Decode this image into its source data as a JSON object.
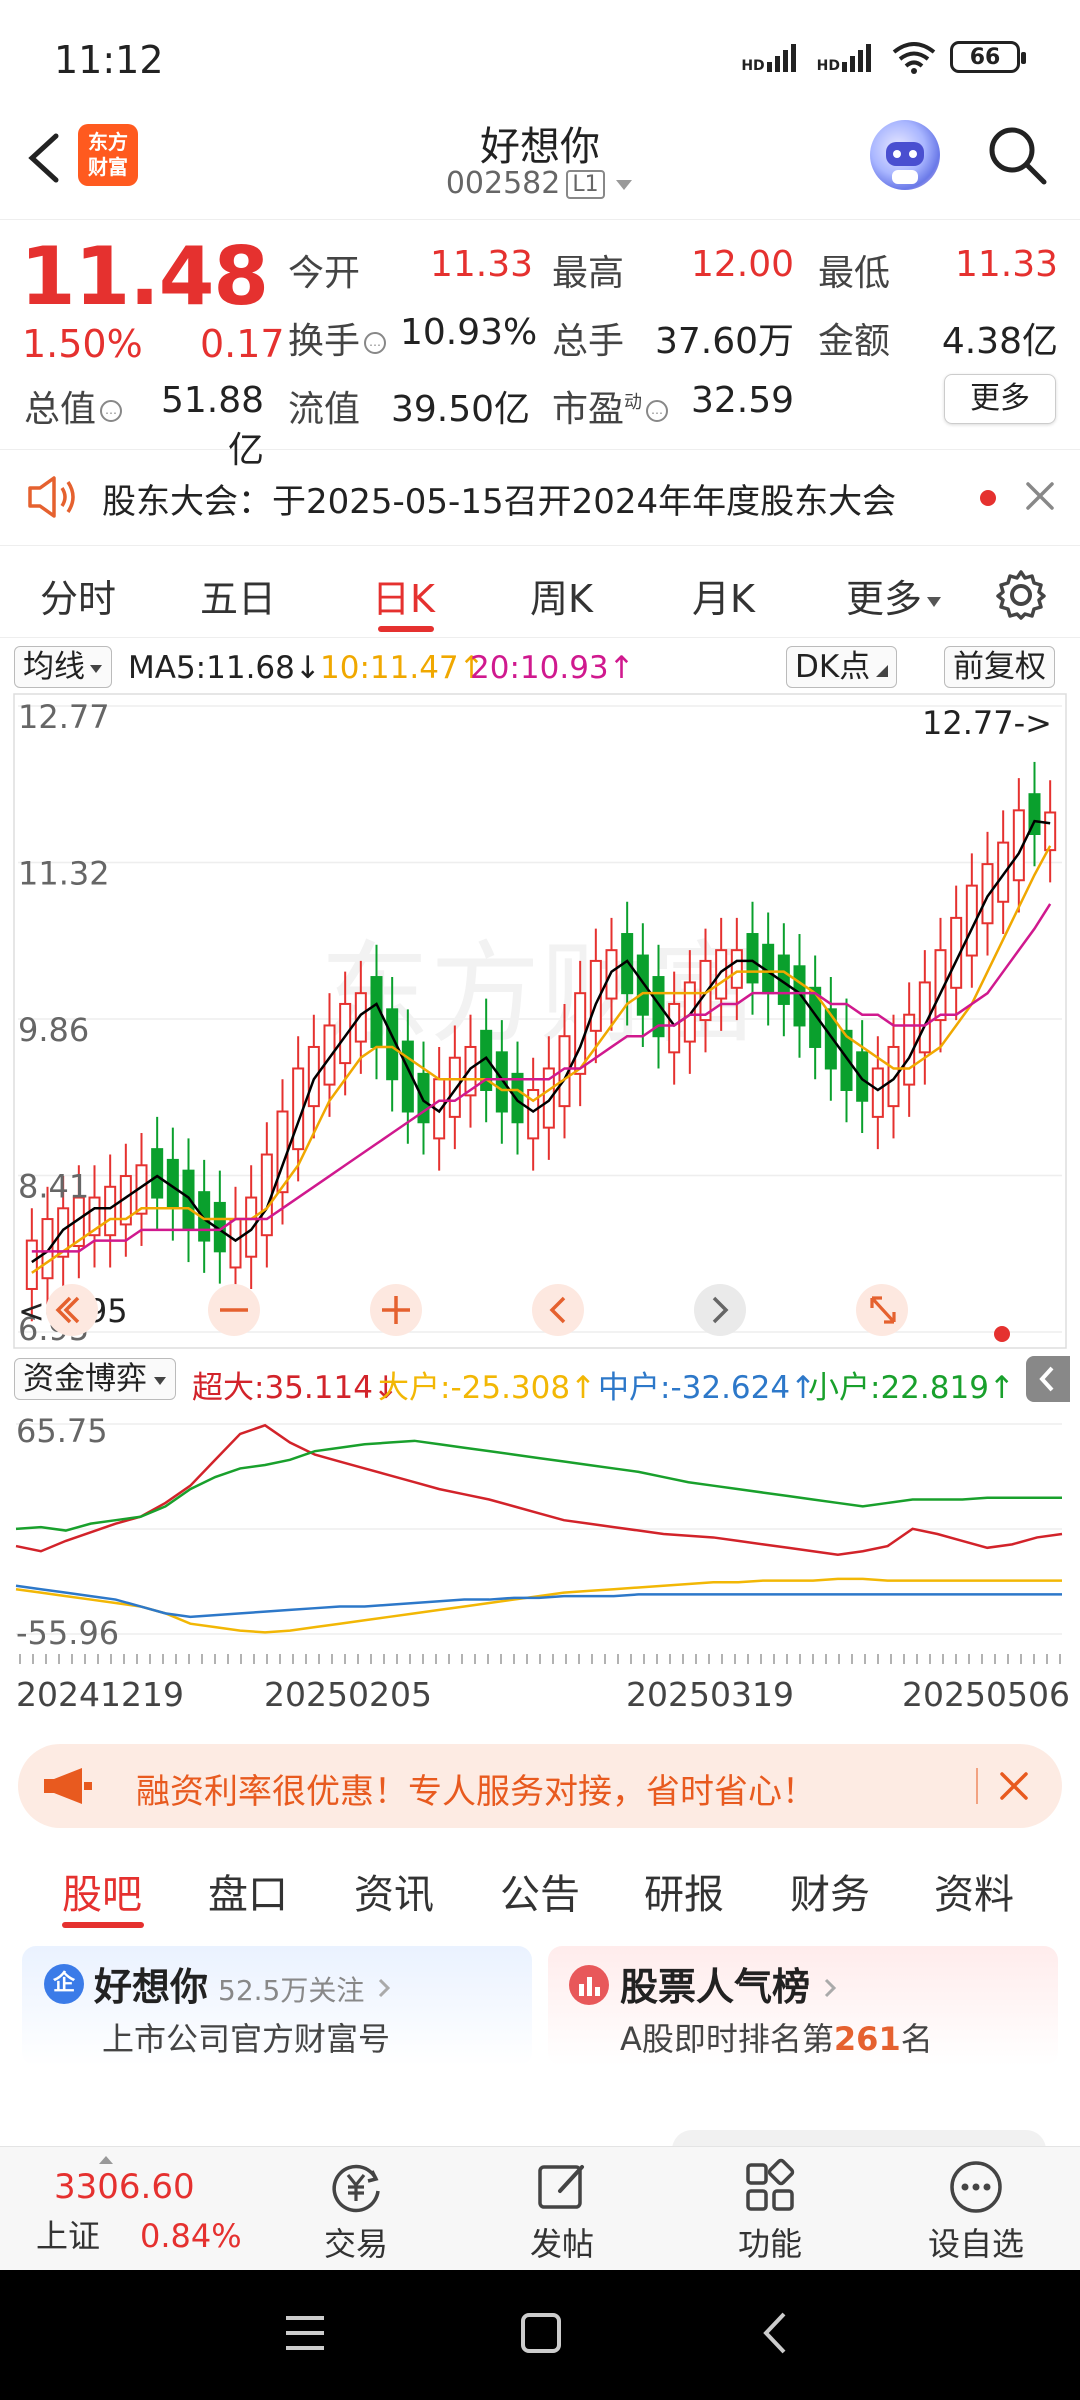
{
  "status_bar": {
    "time": "11:12",
    "battery": "66",
    "signal_label": "HD"
  },
  "header": {
    "stock_name": "好想你",
    "stock_code": "002582",
    "level_badge": "L1",
    "app_logo_line1": "东方",
    "app_logo_line2": "财富"
  },
  "quote": {
    "price": "11.48",
    "change_pct": "1.50%",
    "change_abs": "0.17",
    "fields": {
      "open_label": "今开",
      "open": "11.33",
      "high_label": "最高",
      "high": "12.00",
      "low_label": "最低",
      "low": "11.33",
      "turnover_label": "换手",
      "turnover": "10.93%",
      "volume_label": "总手",
      "volume": "37.60万",
      "amount_label": "金额",
      "amount": "4.38亿",
      "mktcap_label": "总值",
      "mktcap": "51.88亿",
      "float_label": "流值",
      "float": "39.50亿",
      "pe_label": "市盈",
      "pe_sup": "动",
      "pe": "32.59"
    },
    "more_label": "更多"
  },
  "notice": {
    "text": "股东大会：于2025-05-15召开2024年年度股东大会"
  },
  "period_tabs": [
    "分时",
    "五日",
    "日K",
    "周K",
    "月K",
    "更多"
  ],
  "period_active": 2,
  "indicator_bar": {
    "ma_dropdown": "均线",
    "ma5": "MA5:11.68",
    "ma10": "10:11.47",
    "ma20": "20:10.93",
    "dk_dropdown": "DK点",
    "fq_button": "前复权"
  },
  "colors": {
    "rise": "#e5312f",
    "fall": "#0aa02d",
    "ma5": "#000000",
    "ma10": "#f0a800",
    "ma20": "#d0198e",
    "big": "#d2232a",
    "large": "#f2b705",
    "medium": "#2d78c9",
    "small": "#19a02c"
  },
  "chart_data": [
    {
      "type": "candlestick",
      "title": "",
      "ylim": [
        6.95,
        12.77
      ],
      "y_ticks": [
        "12.77",
        "11.32",
        "9.86",
        "8.41",
        "6.95"
      ],
      "annotations": {
        "max": "12.77->",
        "min": "<-6.95"
      },
      "series": [
        {
          "name": "MA5",
          "values": [
            7.6,
            7.7,
            7.9,
            8.0,
            8.1,
            8.1,
            8.2,
            8.3,
            8.4,
            8.3,
            8.2,
            8.0,
            7.9,
            7.8,
            7.9,
            8.1,
            8.5,
            8.9,
            9.3,
            9.5,
            9.7,
            9.9,
            10.0,
            9.7,
            9.4,
            9.1,
            9.0,
            9.2,
            9.4,
            9.5,
            9.3,
            9.1,
            9.0,
            9.1,
            9.3,
            9.6,
            10.0,
            10.3,
            10.4,
            10.2,
            10.0,
            9.8,
            9.9,
            10.1,
            10.3,
            10.4,
            10.4,
            10.3,
            10.2,
            10.1,
            9.9,
            9.7,
            9.5,
            9.3,
            9.2,
            9.3,
            9.5,
            9.8,
            10.1,
            10.4,
            10.7,
            11.0,
            11.2,
            11.4,
            11.7,
            11.68
          ]
        },
        {
          "name": "MA10",
          "values": [
            7.5,
            7.6,
            7.7,
            7.8,
            7.9,
            8.0,
            8.0,
            8.1,
            8.1,
            8.1,
            8.1,
            8.0,
            8.0,
            8.0,
            8.0,
            8.1,
            8.3,
            8.5,
            8.8,
            9.1,
            9.3,
            9.5,
            9.6,
            9.6,
            9.5,
            9.4,
            9.3,
            9.3,
            9.3,
            9.3,
            9.2,
            9.2,
            9.1,
            9.2,
            9.3,
            9.4,
            9.6,
            9.8,
            10.0,
            10.1,
            10.1,
            10.1,
            10.1,
            10.1,
            10.2,
            10.3,
            10.3,
            10.3,
            10.3,
            10.2,
            10.1,
            9.9,
            9.7,
            9.6,
            9.5,
            9.4,
            9.4,
            9.5,
            9.6,
            9.8,
            10.0,
            10.3,
            10.6,
            10.9,
            11.2,
            11.47
          ]
        },
        {
          "name": "MA20",
          "values": [
            7.7,
            7.7,
            7.7,
            7.7,
            7.8,
            7.8,
            7.8,
            7.9,
            7.9,
            7.9,
            7.9,
            7.9,
            7.9,
            8.0,
            8.0,
            8.0,
            8.1,
            8.2,
            8.3,
            8.4,
            8.5,
            8.6,
            8.7,
            8.8,
            8.9,
            9.0,
            9.1,
            9.1,
            9.2,
            9.3,
            9.3,
            9.3,
            9.3,
            9.3,
            9.4,
            9.4,
            9.5,
            9.6,
            9.7,
            9.7,
            9.8,
            9.8,
            9.9,
            9.9,
            10.0,
            10.0,
            10.1,
            10.1,
            10.1,
            10.1,
            10.1,
            10.0,
            10.0,
            9.9,
            9.9,
            9.8,
            9.8,
            9.8,
            9.9,
            9.9,
            10.0,
            10.1,
            10.3,
            10.5,
            10.7,
            10.93
          ]
        }
      ]
    },
    {
      "type": "line",
      "title": "资金博弈",
      "ylim": [
        -55.96,
        65.75
      ],
      "y_ticks": [
        "65.75",
        "-55.96"
      ],
      "x_ticks": [
        "20241219",
        "20250205",
        "20250319",
        "20250506"
      ],
      "series": [
        {
          "name": "超大",
          "label": "超大:35.114",
          "values": [
            -5,
            -8,
            -2,
            3,
            8,
            12,
            20,
            30,
            45,
            60,
            65,
            55,
            48,
            44,
            40,
            36,
            32,
            28,
            25,
            22,
            18,
            14,
            10,
            8,
            6,
            4,
            2,
            1,
            0,
            -2,
            -4,
            -6,
            -8,
            -10,
            -8,
            -5,
            5,
            2,
            -2,
            -6,
            -4,
            0,
            2
          ]
        },
        {
          "name": "大户",
          "label": "大户:-25.308",
          "values": [
            -30,
            -32,
            -34,
            -36,
            -38,
            -40,
            -44,
            -50,
            -52,
            -54,
            -55,
            -54,
            -52,
            -50,
            -48,
            -46,
            -44,
            -42,
            -40,
            -38,
            -36,
            -34,
            -32,
            -31,
            -30,
            -29,
            -28,
            -27,
            -26,
            -26,
            -25,
            -25,
            -25,
            -24,
            -24,
            -25,
            -25,
            -25,
            -25,
            -25,
            -25,
            -25,
            -25
          ]
        },
        {
          "name": "中户",
          "label": "中户:-32.624",
          "values": [
            -28,
            -30,
            -32,
            -34,
            -36,
            -40,
            -44,
            -46,
            -45,
            -44,
            -43,
            -42,
            -41,
            -40,
            -40,
            -39,
            -38,
            -37,
            -36,
            -36,
            -35,
            -35,
            -34,
            -34,
            -34,
            -33,
            -33,
            -33,
            -33,
            -33,
            -33,
            -33,
            -33,
            -33,
            -33,
            -33,
            -33,
            -33,
            -33,
            -33,
            -33,
            -33,
            -33
          ]
        },
        {
          "name": "小户",
          "label": "小户:22.819",
          "values": [
            5,
            6,
            4,
            8,
            10,
            12,
            18,
            28,
            35,
            40,
            42,
            45,
            50,
            52,
            54,
            55,
            56,
            54,
            52,
            50,
            48,
            46,
            44,
            42,
            40,
            38,
            35,
            32,
            30,
            28,
            26,
            24,
            22,
            20,
            18,
            20,
            22,
            22,
            22,
            23,
            23,
            23,
            23
          ]
        }
      ]
    }
  ],
  "fund_bar": {
    "dropdown": "资金博弈"
  },
  "ad": {
    "text": "融资利率很优惠！专人服务对接，省时省心！"
  },
  "content_tabs": [
    "股吧",
    "盘口",
    "资讯",
    "公告",
    "研报",
    "财务",
    "资料"
  ],
  "content_active": 0,
  "cards": {
    "company": {
      "title": "好想你",
      "followers": "52.5万关注",
      "subtitle": "上市公司官方财富号",
      "badge": "企"
    },
    "rank": {
      "title": "股票人气榜",
      "subtitle_prefix": "A股即时排名第",
      "rank": "261",
      "subtitle_suffix": "名"
    }
  },
  "bottom_nav": {
    "index_value": "3306.60",
    "index_name": "上证",
    "index_pct": "0.84%",
    "items": [
      "交易",
      "发帖",
      "功能",
      "设自选"
    ]
  }
}
